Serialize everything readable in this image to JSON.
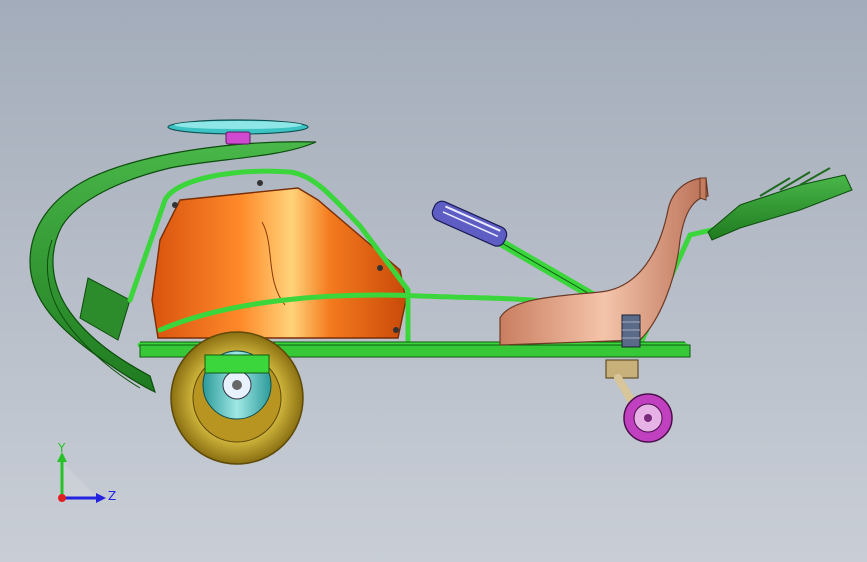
{
  "viewport": {
    "background_top": "#a3acba",
    "background_bottom": "#c9ced6"
  },
  "triad": {
    "y_label": "Y",
    "z_label": "Z",
    "y_color": "#26c226",
    "z_color": "#2323e0",
    "x_color": "#e02020"
  },
  "model": {
    "frame_color": "#3bd63b",
    "body_color": "#f26a1a",
    "seat_color": "#e8a184",
    "fender_color": "#2f9a2f",
    "tire_color": "#c9a82a",
    "hub_color": "#33d0d0",
    "caster_color": "#c040c0",
    "wheel_disk_color": "#38b7b0"
  }
}
